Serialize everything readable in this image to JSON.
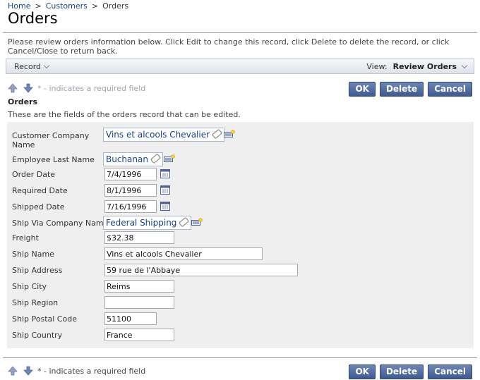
{
  "breadcrumb": {
    "home": "Home",
    "customers": "Customers",
    "current": "Orders",
    "sep": ">"
  },
  "page": {
    "title": "Orders",
    "description": "Please review orders information below. Click Edit to change this record, click Delete to delete the record, or click Cancel/Close to return back."
  },
  "toolbar": {
    "record_label": "Record",
    "view_label": "View:",
    "view_value": "Review Orders"
  },
  "actions": {
    "required_note": "* - indicates a required field",
    "ok": "OK",
    "delete": "Delete",
    "cancel": "Cancel"
  },
  "section": {
    "title": "Orders",
    "description": "These are the fields of the orders record that can be edited."
  },
  "fields": {
    "customer_company_name": {
      "label": "Customer Company Name",
      "value": "Vins et alcools Chevalier"
    },
    "employee_last_name": {
      "label": "Employee Last Name",
      "value": "Buchanan"
    },
    "order_date": {
      "label": "Order Date",
      "value": "7/4/1996"
    },
    "required_date": {
      "label": "Required Date",
      "value": "8/1/1996"
    },
    "shipped_date": {
      "label": "Shipped Date",
      "value": "7/16/1996"
    },
    "ship_via_company_name": {
      "label": "Ship Via Company Name",
      "value": "Federal Shipping"
    },
    "freight": {
      "label": "Freight",
      "value": "$32.38"
    },
    "ship_name": {
      "label": "Ship Name",
      "value": "Vins et alcools Chevalier"
    },
    "ship_address": {
      "label": "Ship Address",
      "value": "59 rue de l'Abbaye"
    },
    "ship_city": {
      "label": "Ship City",
      "value": "Reims"
    },
    "ship_region": {
      "label": "Ship Region",
      "value": ""
    },
    "ship_postal_code": {
      "label": "Ship Postal Code",
      "value": "51100"
    },
    "ship_country": {
      "label": "Ship Country",
      "value": "France"
    }
  },
  "colors": {
    "button": "#3e5a90",
    "link": "#15428b",
    "panel": "#efefef"
  }
}
